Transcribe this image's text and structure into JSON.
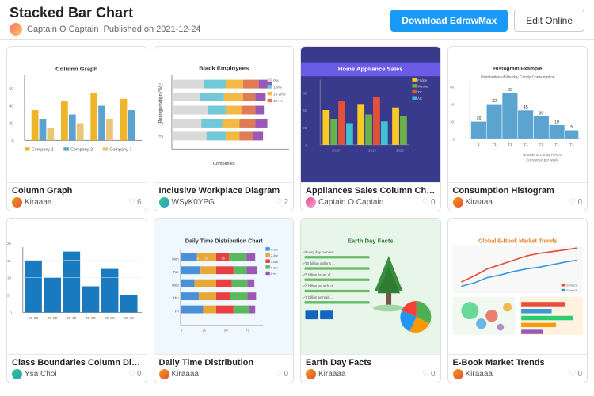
{
  "header": {
    "title": "Stacked Bar Chart",
    "author": "Captain O Captain",
    "published": "Published on 2021-12-24",
    "btn_download": "Download EdrawMax",
    "btn_edit": "Edit Online"
  },
  "cards": [
    {
      "id": "column-graph",
      "title": "Column Graph",
      "author": "Kiraaaa",
      "avatar": "orange",
      "likes": "6",
      "thumb_type": "column-graph"
    },
    {
      "id": "inclusive-workplace",
      "title": "Inclusive Workplace Diagram",
      "author": "WSyK0YPG",
      "avatar": "blue",
      "likes": "2",
      "thumb_type": "inclusive-workplace"
    },
    {
      "id": "appliances-sales",
      "title": "Appliances Sales Column Chart",
      "author": "Captain O Captain",
      "avatar": "pink",
      "likes": "0",
      "thumb_type": "appliances"
    },
    {
      "id": "consumption-histogram",
      "title": "Consumption Histogram",
      "author": "Kiraaaa",
      "avatar": "orange",
      "likes": "0",
      "thumb_type": "histogram"
    },
    {
      "id": "class-boundaries",
      "title": "Class Boundaries Column Diagram",
      "author": "Ysa Choi",
      "avatar": "blue",
      "likes": "0",
      "thumb_type": "class-boundaries"
    },
    {
      "id": "daily-time",
      "title": "Daily Time Distribution",
      "author": "Kiraaaa",
      "avatar": "orange",
      "likes": "0",
      "thumb_type": "daily-time"
    },
    {
      "id": "earth-day",
      "title": "Earth Day Facts",
      "author": "Kiraaaa",
      "avatar": "orange",
      "likes": "0",
      "thumb_type": "earth-day"
    },
    {
      "id": "ebook-market",
      "title": "E-Book Market Trends",
      "author": "Kiraaaa",
      "avatar": "orange",
      "likes": "0",
      "thumb_type": "ebook"
    }
  ]
}
